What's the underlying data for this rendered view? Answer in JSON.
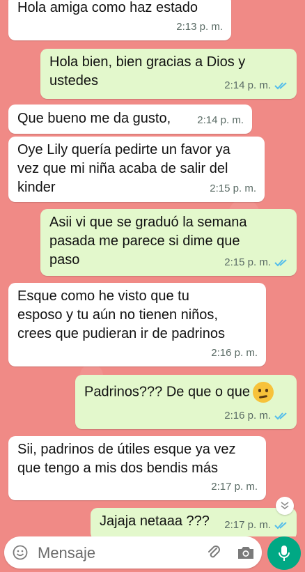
{
  "messages": [
    {
      "direction": "in",
      "text": "Hola amiga como haz estado",
      "time": "2:13 p. m."
    },
    {
      "direction": "out",
      "text": "Hola bien, bien gracias a Dios y\nustedes",
      "time": "2:14 p. m.",
      "status": "read"
    },
    {
      "direction": "in",
      "text": "Que bueno me da gusto,",
      "time": "2:14 p. m."
    },
    {
      "direction": "in",
      "text": "Oye Lily quería pedirte un favor ya\nvez que mi niña acaba de salir del\nkinder",
      "time": "2:15 p. m."
    },
    {
      "direction": "out",
      "text": "Asii vi que se graduó la semana\npasada me parece si dime que\npaso",
      "time": "2:15 p. m.",
      "status": "read"
    },
    {
      "direction": "in",
      "text": "Esque como he visto que tu\nesposo y tu aún no tienen niños,\ncrees que pudieran ir de padrinos",
      "time": "2:16 p. m."
    },
    {
      "direction": "out",
      "text": "Padrinos??? De que o que",
      "emoji": "thinking-face",
      "time": "2:16 p. m.",
      "status": "read"
    },
    {
      "direction": "in",
      "text": "Sii, padrinos de útiles esque ya vez\nque tengo a mis dos bendis  más",
      "time": "2:17 p. m."
    },
    {
      "direction": "out",
      "text": "Jajaja netaaa ???",
      "time": "2:17 p. m.",
      "status": "read"
    }
  ],
  "composer": {
    "placeholder": "Mensaje"
  },
  "colors": {
    "wallpaper": "#f08a86",
    "incoming_bubble": "#ffffff",
    "outgoing_bubble": "#e3f8cc",
    "read_ticks": "#53bdeb",
    "send_button": "#00a884"
  },
  "icons": {
    "emoji": "emoji-icon",
    "attach": "paperclip-icon",
    "camera": "camera-icon",
    "mic": "microphone-icon",
    "scroll_down": "chevron-double-down-icon",
    "read_status": "double-check-icon"
  }
}
